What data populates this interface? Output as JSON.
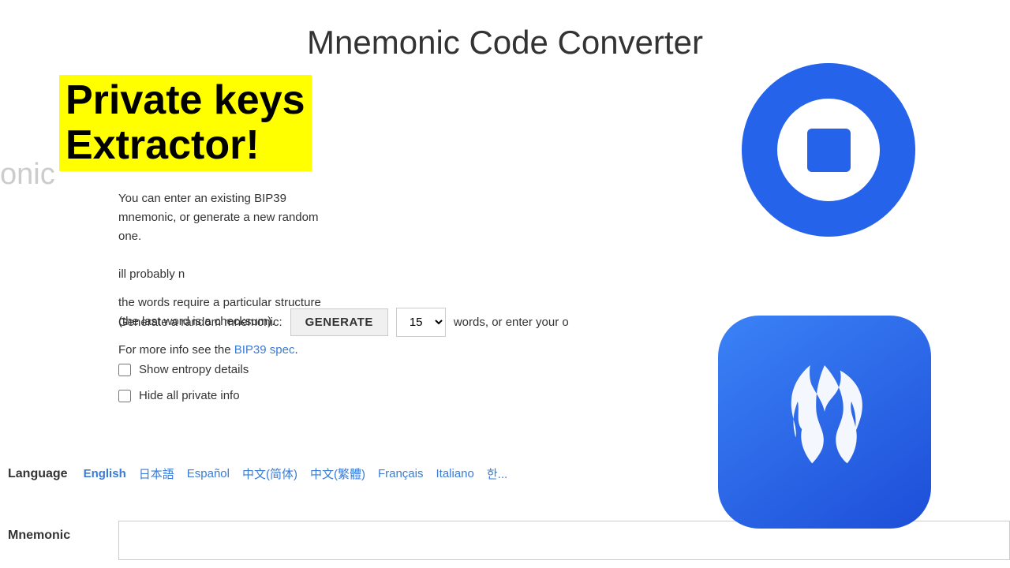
{
  "page": {
    "title": "Mnemonic Code Converter"
  },
  "banner": {
    "line1": "Private keys",
    "line2": "Extractor!"
  },
  "left_edge": "onic",
  "description": {
    "para1": "You can enter an existing BIP39 mnemonic, or generate a new random one.                                                                                      ill probably n",
    "para2": "the words require a particular structure (the last word is a checksum).",
    "para3_prefix": "For more info see the ",
    "link_text": "BIP39 spec",
    "para3_suffix": "."
  },
  "generate": {
    "label": "Generate a random mnemonic:",
    "button_label": "GENERATE",
    "words_value": "15",
    "words_suffix": "words, or enter your o"
  },
  "options": {
    "entropy_label": "Show entropy details",
    "hide_label": "Hide all private info"
  },
  "language": {
    "label": "Language",
    "items": [
      {
        "text": "English",
        "active": true
      },
      {
        "text": "日本語",
        "active": false
      },
      {
        "text": "Español",
        "active": false
      },
      {
        "text": "中文(简体)",
        "active": false
      },
      {
        "text": "中文(繁體)",
        "active": false
      },
      {
        "text": "Français",
        "active": false
      },
      {
        "text": "Italiano",
        "active": false
      },
      {
        "text": "한...",
        "active": false
      }
    ]
  },
  "mnemonic": {
    "label": "Mnemonic",
    "placeholder": ""
  }
}
